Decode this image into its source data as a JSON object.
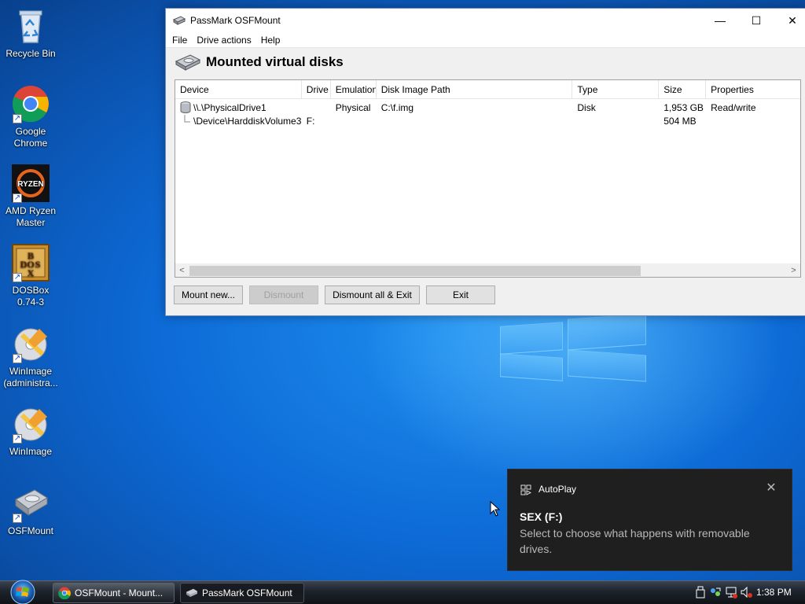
{
  "desktop": {
    "icons": [
      {
        "label": "Recycle Bin",
        "icon": "recycle-bin-icon"
      },
      {
        "label": "Google Chrome",
        "icon": "chrome-icon"
      },
      {
        "label": "AMD Ryzen Master",
        "icon": "ryzen-master-icon"
      },
      {
        "label": "DOSBox 0.74-3",
        "icon": "dosbox-icon"
      },
      {
        "label": "WinImage (administra...",
        "icon": "winimage-icon"
      },
      {
        "label": "WinImage",
        "icon": "winimage-icon"
      },
      {
        "label": "OSFMount",
        "icon": "osfmount-icon"
      }
    ]
  },
  "window": {
    "title": "PassMark OSFMount",
    "controls": {
      "minimize": "—",
      "maximize": "☐",
      "close": "✕"
    },
    "menu": [
      "File",
      "Drive actions",
      "Help"
    ],
    "heading": "Mounted virtual disks",
    "table": {
      "columns": [
        "Device",
        "Drive",
        "Emulation",
        "Disk Image Path",
        "Type",
        "Size",
        "Properties"
      ],
      "rows": [
        {
          "device": "\\\\.\\PhysicalDrive1",
          "drive": "",
          "emulation": "Physical",
          "path": "C:\\f.img",
          "type": "Disk",
          "size": "1,953 GB",
          "properties": "Read/write"
        },
        {
          "device": "\\Device\\HarddiskVolume3",
          "drive": "F:",
          "emulation": "",
          "path": "",
          "type": "",
          "size": "504 MB",
          "properties": ""
        }
      ]
    },
    "scrollbar": {
      "left_arrow": "<",
      "right_arrow": ">"
    },
    "buttons": {
      "mount_new": "Mount new...",
      "dismount": "Dismount",
      "dismount_all_exit": "Dismount all & Exit",
      "exit": "Exit"
    }
  },
  "taskbar": {
    "tasks": [
      {
        "label": "OSFMount - Mount...",
        "icon": "chrome-icon",
        "active": false
      },
      {
        "label": "PassMark OSFMount",
        "icon": "osfmount-icon",
        "active": true
      }
    ],
    "clock": "1:38 PM"
  },
  "toast": {
    "app": "AutoPlay",
    "close": "✕",
    "title": "SEX (F:)",
    "body": "Select to choose what happens with removable drives."
  },
  "colors": {
    "accent": "#0078d7",
    "toast_bg": "#1f1f1f",
    "desktop_blue": "#0d6ad6"
  }
}
